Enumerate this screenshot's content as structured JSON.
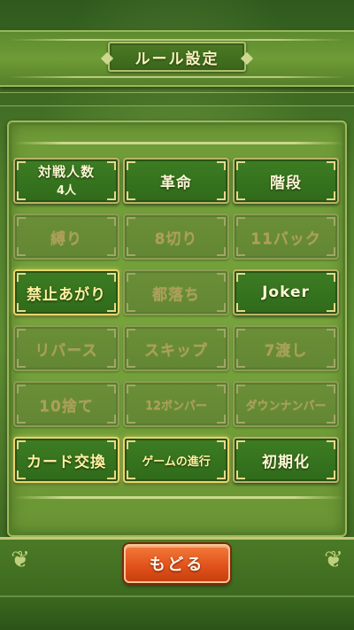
{
  "header": {
    "title": "ルール設定"
  },
  "options": [
    {
      "key": "taisen",
      "label": "対戦人数",
      "sub": "4人",
      "state": "on"
    },
    {
      "key": "kakumei",
      "label": "革命",
      "state": "on"
    },
    {
      "key": "kaidan",
      "label": "階段",
      "state": "on"
    },
    {
      "key": "shibari",
      "label": "縛り",
      "state": "off"
    },
    {
      "key": "8giri",
      "label": "8切り",
      "state": "off"
    },
    {
      "key": "11back",
      "label": "11バック",
      "state": "off"
    },
    {
      "key": "kinshi",
      "label": "禁止あがり",
      "state": "on_highlight"
    },
    {
      "key": "miyako",
      "label": "都落ち",
      "state": "off"
    },
    {
      "key": "joker",
      "label": "Joker",
      "state": "on"
    },
    {
      "key": "reverse",
      "label": "リバース",
      "state": "off"
    },
    {
      "key": "skip",
      "label": "スキップ",
      "state": "off"
    },
    {
      "key": "7watashi",
      "label": "7渡し",
      "state": "off"
    },
    {
      "key": "10sute",
      "label": "10捨て",
      "state": "off"
    },
    {
      "key": "12bomber",
      "label": "12ボンバー",
      "state": "off"
    },
    {
      "key": "down",
      "label": "ダウンナンバー",
      "state": "off"
    },
    {
      "key": "card_koukan",
      "label": "カード交換",
      "state": "on_highlight"
    },
    {
      "key": "game_shinkou",
      "label": "ゲームの進行",
      "state": "on_highlight"
    },
    {
      "key": "shokika",
      "label": "初期化",
      "state": "on"
    }
  ],
  "footer": {
    "back_label": "もどる"
  },
  "colors": {
    "accent": "#e2531c",
    "on": "#2f6a1a",
    "off": "#628633",
    "gold": "#e8d66a"
  }
}
